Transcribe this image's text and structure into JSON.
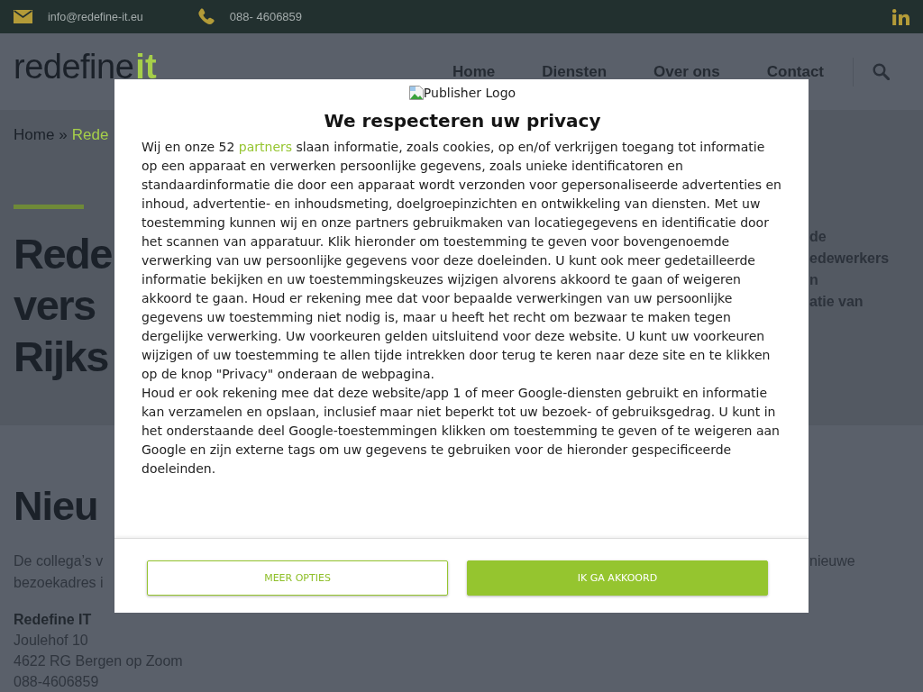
{
  "top_bar": {
    "email": "info@redefine-it.eu",
    "phone": "088- 4606859"
  },
  "header": {
    "logo": {
      "word": "redefine",
      "accent": "it"
    },
    "nav": [
      {
        "label": "Home"
      },
      {
        "label": "Diensten"
      },
      {
        "label": "Over ons"
      },
      {
        "label": "Contact"
      }
    ]
  },
  "breadcrumb": [
    {
      "label": "Home",
      "kind": "link"
    },
    {
      "label": "»",
      "kind": "separator"
    },
    {
      "label": "Rede",
      "kind": "current"
    }
  ],
  "hero": {
    "title_lines": [
      "Rede",
      "vers",
      "Rijks"
    ],
    "side_lines": [
      "de",
      "edewerkers",
      "n",
      "atie van"
    ]
  },
  "section": {
    "heading": "Nieu",
    "paragraph_lines": [
      "De collega’s v",
      "bezoekadres i"
    ],
    "side_text": "nieuwe",
    "address": [
      {
        "text": "Redefine IT",
        "kind": "name"
      },
      {
        "text": "Joulehof 10",
        "kind": "line"
      },
      {
        "text": "4622 RG Bergen op Zoom",
        "kind": "line"
      },
      {
        "text": "088-4606859",
        "kind": "line"
      }
    ]
  },
  "consent_dialog": {
    "logo_alt": "Publisher Logo",
    "title": "We respecteren uw privacy",
    "paragraphs": [
      {
        "segments": [
          {
            "kind": "text",
            "text": "Wij en onze 52 "
          },
          {
            "kind": "link",
            "text": "partners"
          },
          {
            "kind": "text",
            "text": " slaan informatie, zoals cookies, op en/of verkrijgen toegang tot informatie op een apparaat en verwerken persoonlijke gegevens, zoals unieke identificatoren en standaardinformatie die door een apparaat wordt verzonden voor gepersonaliseerde advertenties en inhoud, advertentie- en inhoudsmeting, doelgroepinzichten en ontwikkeling van diensten. Met uw toestemming kunnen wij en onze partners gebruikmaken van locatiegegevens en identificatie door het scannen van apparatuur. Klik hieronder om toestemming te geven voor bovengenoemde verwerking van uw persoonlijke gegevens voor deze doeleinden. U kunt ook meer gedetailleerde informatie bekijken en uw toestemmingskeuzes wijzigen alvorens akkoord te gaan of weigeren akkoord te gaan. Houd er rekening mee dat voor bepaalde verwerkingen van uw persoonlijke gegevens uw toestemming niet nodig is, maar u heeft het recht om bezwaar te maken tegen dergelijke verwerking. Uw voorkeuren gelden uitsluitend voor deze website. U kunt uw voorkeuren wijzigen of uw toestemming te allen tijde intrekken door terug te keren naar deze site en te klikken op de knop \"Privacy\" onderaan de webpagina."
          }
        ]
      },
      {
        "segments": [
          {
            "kind": "text",
            "text": "Houd er ook rekening mee dat deze website/app 1 of meer Google-diensten gebruikt en informatie kan verzamelen en opslaan, inclusief maar niet beperkt tot uw bezoek- of gebruiksgedrag. U kunt in het onderstaande deel Google-toestemmingen klikken om toestemming te geven of te weigeren aan Google en zijn externe tags om uw gegevens te gebruiken voor de hieronder gespecificeerde doeleinden."
          }
        ]
      }
    ],
    "buttons": [
      {
        "label": "MEER OPTIES",
        "kind": "secondary"
      },
      {
        "label": "IK GA AKKOORD",
        "kind": "primary"
      }
    ]
  }
}
